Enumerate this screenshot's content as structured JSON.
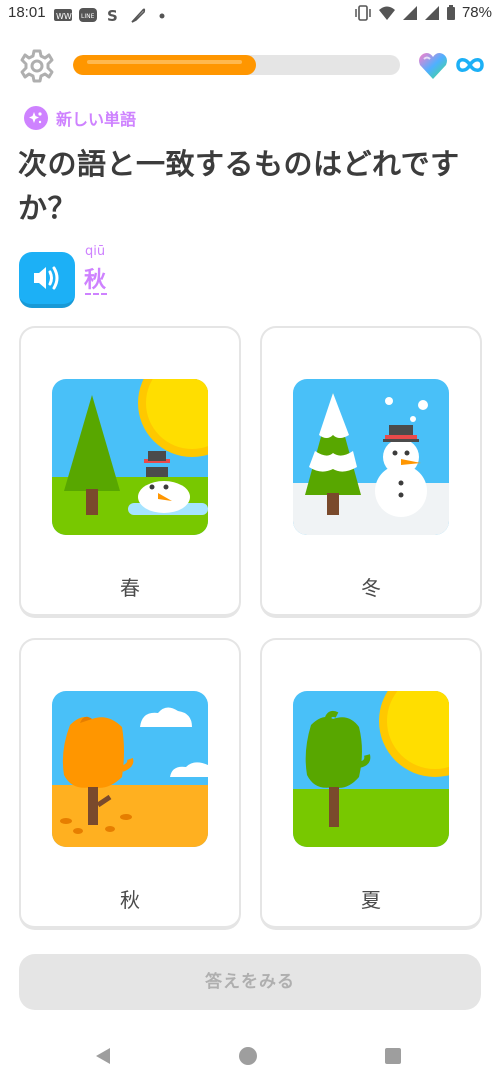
{
  "status_bar": {
    "time": "18:01",
    "battery": "78%",
    "icons": [
      "ww-app-icon",
      "line-icon",
      "s-app-icon",
      "feather-icon",
      "dot-icon",
      "vibrate-icon",
      "wifi-icon",
      "signal-icon",
      "signal-icon",
      "battery-icon"
    ]
  },
  "header": {
    "progress_fraction": 0.56,
    "progress_color": "#ff9600",
    "hearts_icon": "gem-heart-icon",
    "hearts_value_icon": "infinity-icon"
  },
  "lesson": {
    "tag_label": "新しい単語",
    "question": "次の語と一致するものはどれですか？",
    "pinyin": "qiū",
    "word": "秋"
  },
  "choices": [
    {
      "label": "春",
      "image": "spring-snowman-melting-icon"
    },
    {
      "label": "冬",
      "image": "winter-snowman-icon"
    },
    {
      "label": "秋",
      "image": "autumn-tree-icon"
    },
    {
      "label": "夏",
      "image": "summer-tree-sun-icon"
    }
  ],
  "check_button": {
    "label": "答えをみる",
    "enabled": false
  },
  "colors": {
    "accent_purple": "#ce82ff",
    "audio_blue": "#1cb0f6",
    "progress_orange": "#ff9600",
    "border_gray": "#e5e5e5"
  }
}
